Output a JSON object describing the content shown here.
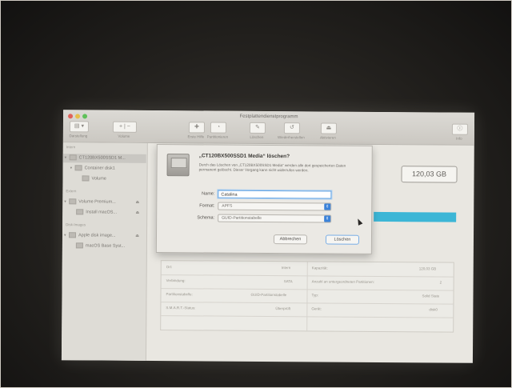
{
  "window": {
    "title": "Festplattendienstprogramm",
    "toolbar": {
      "darstellung_label": "Darstellung",
      "volume_label": "Volume",
      "erste_hilfe_label": "Erste Hilfe",
      "partitionieren_label": "Partitionieren",
      "loeschen_label": "Löschen",
      "wiederherstellen_label": "Wiederherstellen",
      "aktivieren_label": "Aktivieren",
      "info_label": "Info"
    }
  },
  "sidebar": {
    "section_intern": "Intern",
    "section_extern": "Extern",
    "section_images": "Disk-Images",
    "items": [
      {
        "label": "CT120BX500SSD1 M..."
      },
      {
        "label": "Container disk1"
      },
      {
        "label": "Volume"
      },
      {
        "label": "Volume Premium..."
      },
      {
        "label": "Install macOS..."
      },
      {
        "label": "Apple disk image..."
      },
      {
        "label": "macOS Base Syst..."
      }
    ]
  },
  "main": {
    "capacity": "120,03 GB",
    "info_rows": [
      {
        "left_label": "Ort:",
        "left_value": "Intern",
        "right_label": "Kapazität:",
        "right_value": "120,03 GB"
      },
      {
        "left_label": "Verbindung:",
        "left_value": "SATA",
        "right_label": "Anzahl an untergeordneten Partitionen:",
        "right_value": "2"
      },
      {
        "left_label": "Partitionstabelle:",
        "left_value": "GUID-Partitionstabelle",
        "right_label": "Typ:",
        "right_value": "Solid State"
      },
      {
        "left_label": "S.M.A.R.T.-Status:",
        "left_value": "Überprüft",
        "right_label": "Gerät:",
        "right_value": "disk0"
      }
    ]
  },
  "sheet": {
    "heading": "„CT120BX500SSD1 Media“ löschen?",
    "message": "Durch das Löschen von „CT120BX500SSD1 Media“ werden alle dort gespeicherten Daten permanent gelöscht. Dieser Vorgang kann nicht widerrufen werden.",
    "name_label": "Name:",
    "name_value": "Catalina",
    "format_label": "Format:",
    "format_value": "APFS",
    "scheme_label": "Schema:",
    "scheme_value": "GUID-Partitionstabelle",
    "cancel_label": "Abbrechen",
    "erase_label": "Löschen"
  },
  "colors": {
    "usage_bar": "#3cb6d6",
    "focus_ring": "#6aa7e2",
    "select_arrow": "#3b82d9"
  }
}
